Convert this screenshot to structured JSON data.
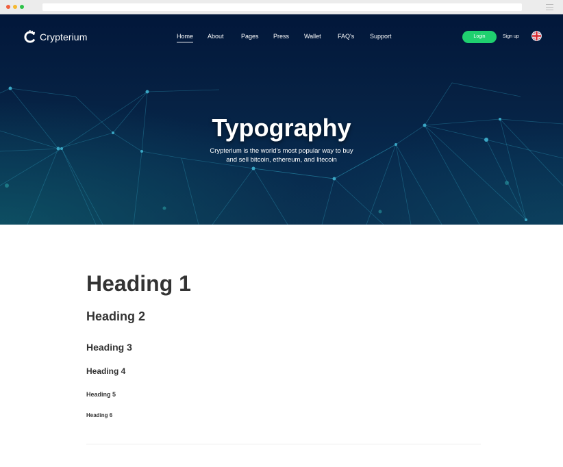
{
  "brand": {
    "name": "Crypterium"
  },
  "nav": {
    "items": [
      {
        "label": "Home",
        "active": true
      },
      {
        "label": "About",
        "active": false
      },
      {
        "label": "Pages",
        "active": false
      },
      {
        "label": "Press",
        "active": false
      },
      {
        "label": "Wallet",
        "active": false
      },
      {
        "label": "FAQ's",
        "active": false
      },
      {
        "label": "Support",
        "active": false
      }
    ],
    "login_label": "Login",
    "signup_label": "Sign up",
    "language_icon": "uk-flag-icon"
  },
  "hero": {
    "title": "Typography",
    "subtitle_line1": "Crypterium is the world's most popular way to buy",
    "subtitle_line2": "and sell bitcoin, ethereum, and litecoin"
  },
  "headings": {
    "h1": "Heading 1",
    "h2": "Heading 2",
    "h3": "Heading 3",
    "h4": "Heading 4",
    "h5": "Heading 5",
    "h6": "Heading 6"
  },
  "colors": {
    "accent": "#1fd06f",
    "hero_bg": "#062143",
    "heading_text": "#333333"
  }
}
